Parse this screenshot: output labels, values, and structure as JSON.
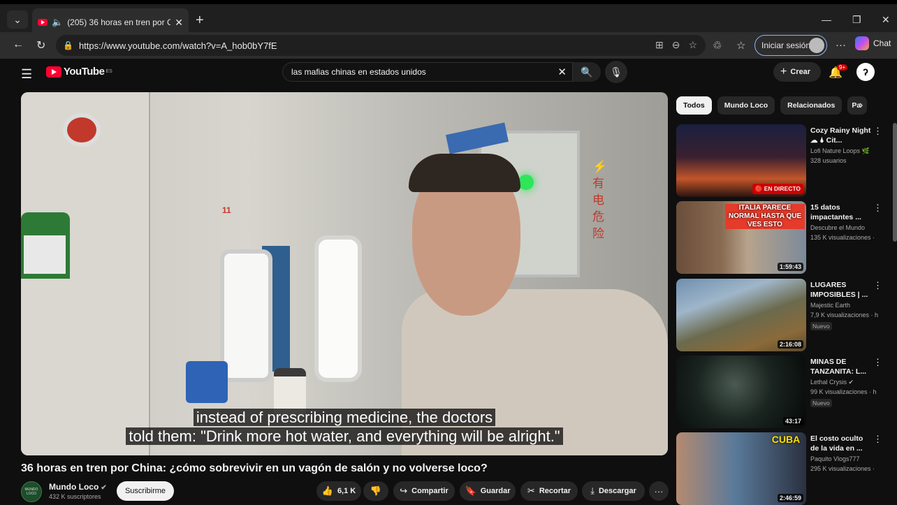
{
  "browser": {
    "tab_title": "(205) 36 horas en tren por Chi",
    "url": "https://www.youtube.com/watch?v=A_hob0bY7fE",
    "signin_label": "Iniciar sesión",
    "chat_label": "Chat"
  },
  "youtube": {
    "logo_text": "YouTube",
    "country_code": "ES",
    "search_value": "las mafias chinas en estados unidos",
    "create_label": "Crear",
    "notification_count": "9+"
  },
  "video": {
    "subtitle_line1": "instead of prescribing medicine, the doctors",
    "subtitle_line2": "told them: \"Drink more hot water, and everything will be alright.\"",
    "title": "36 horas en tren por China: ¿cómo sobrevivir en un vagón de salón y no volverse loco?",
    "channel_name": "Mundo Loco",
    "channel_avatar_text": "MUNDO LOCO",
    "subscribers": "432 K suscriptores",
    "subscribe_label": "Suscribirme",
    "like_count": "6,1 K",
    "share_label": "Compartir",
    "save_label": "Guardar",
    "clip_label": "Recortar",
    "download_label": "Descargar"
  },
  "chips": [
    "Todos",
    "Mundo Loco",
    "Relacionados",
    "Pa"
  ],
  "recommendations": [
    {
      "title": "Cozy Rainy Night ☁ 🌢 Cit...",
      "channel": "Lofi Nature Loops 🌿",
      "meta": "328 usuarios",
      "badge": "🔴 EN DIRECTO",
      "thumb_text": "",
      "new": ""
    },
    {
      "title": "15 datos impactantes ...",
      "channel": "Descubre el Mundo",
      "meta": "135 K visualizaciones ·",
      "badge": "1:59:43",
      "thumb_text": "ITALIA PARECE NORMAL HASTA QUE VES ESTO",
      "new": ""
    },
    {
      "title": "LUGARES IMPOSIBLES | ...",
      "channel": "Majestic Earth",
      "meta": "7,9 K visualizaciones · h",
      "badge": "2:16:08",
      "thumb_text": "",
      "new": "Nuevo"
    },
    {
      "title": "MINAS DE TANZANITA: L...",
      "channel": "Lethal Crysis ✔",
      "meta": "99 K visualizaciones · h",
      "badge": "43:17",
      "thumb_text": "",
      "new": "Nuevo"
    },
    {
      "title": "El costo oculto de la vida en ...",
      "channel": "Paquito Vlogs777",
      "meta": "295 K visualizaciones ·",
      "badge": "2:46:59",
      "thumb_text": "CUBA",
      "new": ""
    }
  ],
  "colors": {
    "youtube_red": "#ff0033",
    "background": "#0f0f0f",
    "button_bg": "#272727"
  },
  "icons": [
    "search-icon",
    "mic-icon",
    "bell-icon",
    "like-icon",
    "dislike-icon",
    "share-icon",
    "save-icon",
    "scissors-icon",
    "download-icon"
  ]
}
